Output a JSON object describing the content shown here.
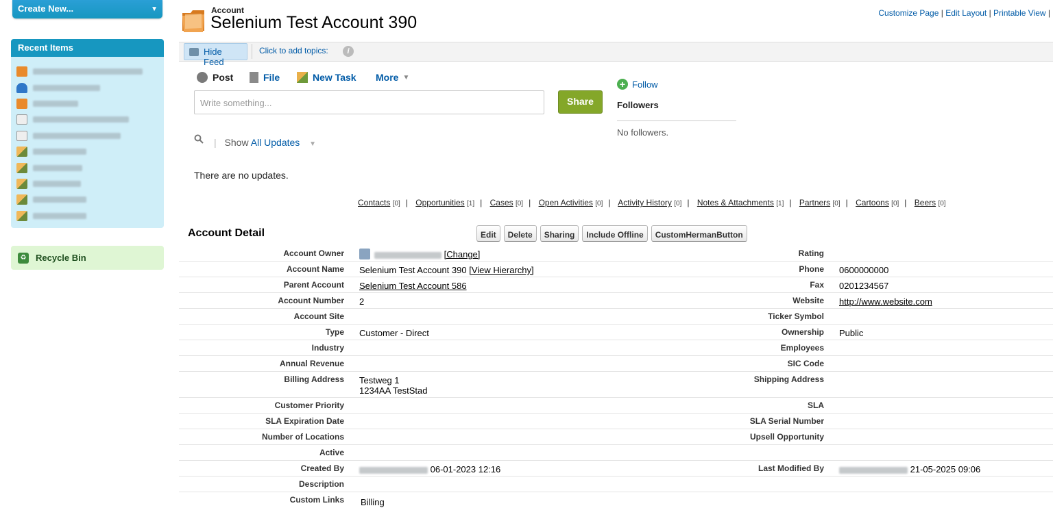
{
  "sidebar": {
    "create_new_label": "Create New...",
    "recent_items_title": "Recent Items",
    "recent_items": [
      {
        "icon": "account-icon"
      },
      {
        "icon": "contact-icon"
      },
      {
        "icon": "account-icon"
      },
      {
        "icon": "document-icon"
      },
      {
        "icon": "document-icon"
      },
      {
        "icon": "pencil-icon"
      },
      {
        "icon": "pencil-icon"
      },
      {
        "icon": "pencil-icon"
      },
      {
        "icon": "pencil-icon"
      },
      {
        "icon": "pencil-icon"
      }
    ],
    "recycle_bin_label": "Recycle Bin"
  },
  "header": {
    "object_label": "Account",
    "record_title": "Selenium Test Account 390",
    "links": [
      "Customize Page",
      "Edit Layout",
      "Printable View"
    ]
  },
  "feedbar": {
    "hide_feed_label": "Hide Feed",
    "topics_label": "Click to add topics:"
  },
  "publisher": {
    "post_label": "Post",
    "file_label": "File",
    "new_task_label": "New Task",
    "more_label": "More",
    "placeholder": "Write something...",
    "share_label": "Share"
  },
  "follow": {
    "follow_label": "Follow",
    "followers_title": "Followers",
    "no_followers": "No followers."
  },
  "feed_filter": {
    "show_label": "Show",
    "selected": "All Updates",
    "no_updates": "There are no updates."
  },
  "related_lists": [
    {
      "label": "Contacts",
      "count": "[0]"
    },
    {
      "label": "Opportunities",
      "count": "[1]"
    },
    {
      "label": "Cases",
      "count": "[0]"
    },
    {
      "label": "Open Activities",
      "count": "[0]"
    },
    {
      "label": "Activity History",
      "count": "[0]"
    },
    {
      "label": "Notes & Attachments",
      "count": "[1]"
    },
    {
      "label": "Partners",
      "count": "[0]"
    },
    {
      "label": "Cartoons",
      "count": "[0]"
    },
    {
      "label": "Beers",
      "count": "[0]"
    }
  ],
  "detail": {
    "title": "Account Detail",
    "buttons": [
      "Edit",
      "Delete",
      "Sharing",
      "Include Offline",
      "CustomHermanButton"
    ],
    "change_link": "[Change]",
    "view_hierarchy_link": "[View Hierarchy]",
    "rows": [
      {
        "left_label": "Account Owner",
        "left_value": "",
        "right_label": "Rating",
        "right_value": ""
      },
      {
        "left_label": "Account Name",
        "left_value": "Selenium Test Account 390",
        "right_label": "Phone",
        "right_value": "0600000000"
      },
      {
        "left_label": "Parent Account",
        "left_value": "Selenium Test Account 586",
        "right_label": "Fax",
        "right_value": "0201234567"
      },
      {
        "left_label": "Account Number",
        "left_value": "2",
        "right_label": "Website",
        "right_value": "http://www.website.com"
      },
      {
        "left_label": "Account Site",
        "left_value": "",
        "right_label": "Ticker Symbol",
        "right_value": ""
      },
      {
        "left_label": "Type",
        "left_value": "Customer - Direct",
        "right_label": "Ownership",
        "right_value": "Public"
      },
      {
        "left_label": "Industry",
        "left_value": "",
        "right_label": "Employees",
        "right_value": ""
      },
      {
        "left_label": "Annual Revenue",
        "left_value": "",
        "right_label": "SIC Code",
        "right_value": ""
      },
      {
        "left_label": "Billing Address",
        "left_value": "Testweg 1",
        "left_value2": "1234AA TestStad",
        "right_label": "Shipping Address",
        "right_value": ""
      },
      {
        "left_label": "Customer Priority",
        "left_value": "",
        "right_label": "SLA",
        "right_value": ""
      },
      {
        "left_label": "SLA Expiration Date",
        "left_value": "",
        "right_label": "SLA Serial Number",
        "right_value": ""
      },
      {
        "left_label": "Number of Locations",
        "left_value": "",
        "right_label": "Upsell Opportunity",
        "right_value": ""
      },
      {
        "left_label": "Active",
        "left_value": "",
        "right_label": "",
        "right_value": ""
      },
      {
        "left_label": "Created By",
        "left_value": "06-01-2023 12:16",
        "right_label": "Last Modified By",
        "right_value": "21-05-2025 09:06"
      },
      {
        "left_label": "Description",
        "left_value": "",
        "right_label": "",
        "right_value": ""
      },
      {
        "left_label": "Custom Links",
        "left_value": "Billing",
        "right_label": "",
        "right_value": ""
      }
    ]
  }
}
